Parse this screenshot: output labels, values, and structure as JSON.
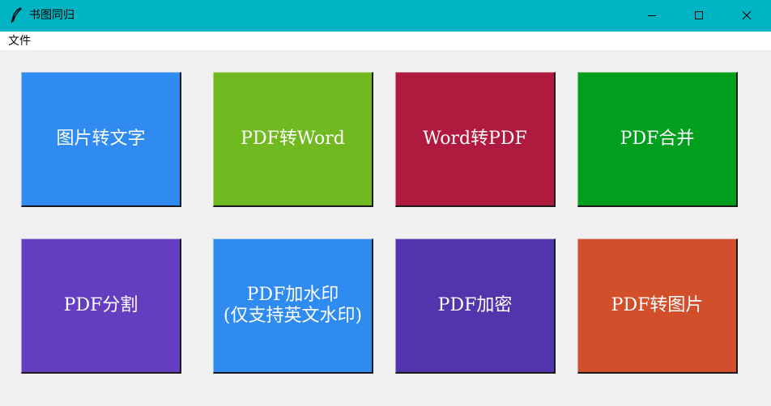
{
  "window": {
    "title": "书图同归",
    "icon": "feather-icon",
    "titlebar_color": "#00b4c4",
    "controls": [
      "minimize-icon",
      "maximize-icon",
      "close-icon"
    ]
  },
  "menubar": {
    "items": [
      {
        "label": "文件"
      }
    ]
  },
  "tiles": [
    {
      "label": "图片转文字",
      "color": "#2f8bef"
    },
    {
      "label": "PDF转Word",
      "color": "#70b921"
    },
    {
      "label": "Word转PDF",
      "color": "#b01a3e"
    },
    {
      "label": "PDF合并",
      "color": "#029f1e"
    },
    {
      "label": "PDF分割",
      "color": "#653dc1"
    },
    {
      "label": "PDF加水印\n(仅支持英文水印)",
      "color": "#2f8bef"
    },
    {
      "label": "PDF加密",
      "color": "#5235ad"
    },
    {
      "label": "PDF转图片",
      "color": "#d34f2b"
    }
  ]
}
